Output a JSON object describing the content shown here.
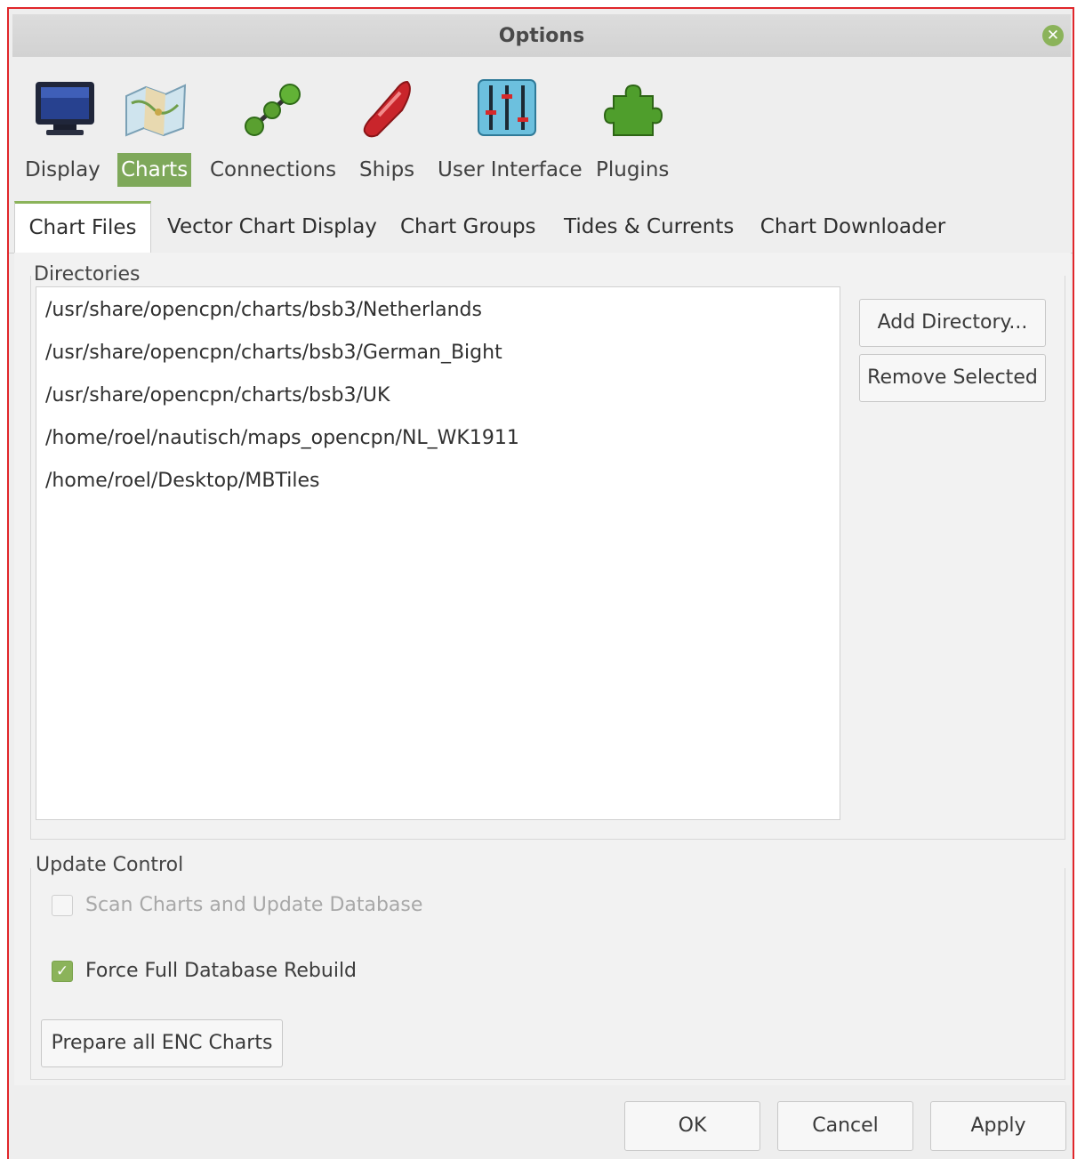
{
  "window": {
    "title": "Options"
  },
  "toolbar": {
    "items": [
      {
        "label": "Display",
        "icon": "monitor-icon"
      },
      {
        "label": "Charts",
        "icon": "charts-map-icon",
        "active": true
      },
      {
        "label": "Connections",
        "icon": "connections-icon"
      },
      {
        "label": "Ships",
        "icon": "ship-icon"
      },
      {
        "label": "User Interface",
        "icon": "sliders-icon"
      },
      {
        "label": "Plugins",
        "icon": "puzzle-icon"
      }
    ]
  },
  "tabs": [
    {
      "label": "Chart Files",
      "active": true
    },
    {
      "label": "Vector Chart Display"
    },
    {
      "label": "Chart Groups"
    },
    {
      "label": "Tides & Currents"
    },
    {
      "label": "Chart Downloader"
    }
  ],
  "directories": {
    "label": "Directories",
    "items": [
      "/usr/share/opencpn/charts/bsb3/Netherlands",
      "/usr/share/opencpn/charts/bsb3/German_Bight",
      "/usr/share/opencpn/charts/bsb3/UK",
      "/home/roel/nautisch/maps_opencpn/NL_WK1911",
      "/home/roel/Desktop/MBTiles"
    ],
    "add_button": "Add Directory...",
    "remove_button": "Remove Selected"
  },
  "update_control": {
    "label": "Update Control",
    "scan_label": "Scan Charts and Update Database",
    "scan_checked": false,
    "scan_enabled": false,
    "rebuild_label": "Force Full Database Rebuild",
    "rebuild_checked": true,
    "prepare_button": "Prepare all ENC Charts"
  },
  "footer": {
    "ok": "OK",
    "cancel": "Cancel",
    "apply": "Apply"
  },
  "colors": {
    "accent": "#8bb35a",
    "window_border": "#e0262b"
  }
}
